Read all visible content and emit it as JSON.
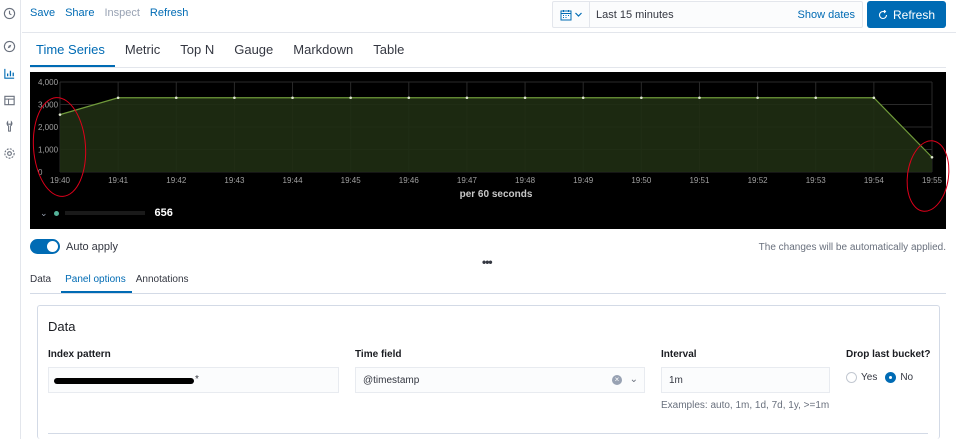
{
  "topmenu": {
    "save": "Save",
    "share": "Share",
    "inspect": "Inspect",
    "refresh": "Refresh"
  },
  "timepicker": {
    "range": "Last 15 minutes",
    "show_dates": "Show dates",
    "refresh_button": "Refresh",
    "calendar_icon": "calendar-icon"
  },
  "rail_icons": [
    "clock-icon",
    "compass-icon",
    "bar-chart-icon",
    "dashboard-icon",
    "wrench-icon",
    "gear-icon"
  ],
  "vis_tabs": [
    {
      "label": "Time Series",
      "active": true
    },
    {
      "label": "Metric",
      "active": false
    },
    {
      "label": "Top N",
      "active": false
    },
    {
      "label": "Gauge",
      "active": false
    },
    {
      "label": "Markdown",
      "active": false
    },
    {
      "label": "Table",
      "active": false
    }
  ],
  "legend": {
    "value": "656"
  },
  "colors": {
    "accent": "#006bb4",
    "series": "#54b399",
    "annotation": "#e0001b"
  },
  "chart_data": {
    "type": "area",
    "x": [
      "19:40",
      "19:41",
      "19:42",
      "19:43",
      "19:44",
      "19:45",
      "19:46",
      "19:47",
      "19:48",
      "19:49",
      "19:50",
      "19:51",
      "19:52",
      "19:53",
      "19:54",
      "19:55"
    ],
    "series": [
      {
        "values": [
          2550,
          3300,
          3300,
          3300,
          3300,
          3300,
          3300,
          3300,
          3300,
          3300,
          3300,
          3300,
          3300,
          3300,
          3300,
          656
        ]
      }
    ],
    "y_ticks": [
      "4,000",
      "3,000",
      "2,000",
      "1,000",
      "0"
    ],
    "ylim": [
      0,
      4000
    ],
    "xlabel": "per 60 seconds",
    "ylabel": "",
    "grid": true
  },
  "auto_apply": {
    "label": "Auto apply",
    "enabled": true,
    "note": "The changes will be automatically applied."
  },
  "editor_tabs": [
    {
      "label": "Data",
      "active": false
    },
    {
      "label": "Panel options",
      "active": true
    },
    {
      "label": "Annotations",
      "active": false
    }
  ],
  "panel": {
    "title": "Data",
    "index_pattern_label": "Index pattern",
    "index_pattern_suffix": "*",
    "time_field_label": "Time field",
    "time_field_value": "@timestamp",
    "interval_label": "Interval",
    "interval_value": "1m",
    "interval_help": "Examples: auto, 1m, 1d, 7d, 1y, >=1m",
    "drop_label": "Drop last bucket?",
    "drop_yes": "Yes",
    "drop_no": "No",
    "drop_selected": "No"
  }
}
